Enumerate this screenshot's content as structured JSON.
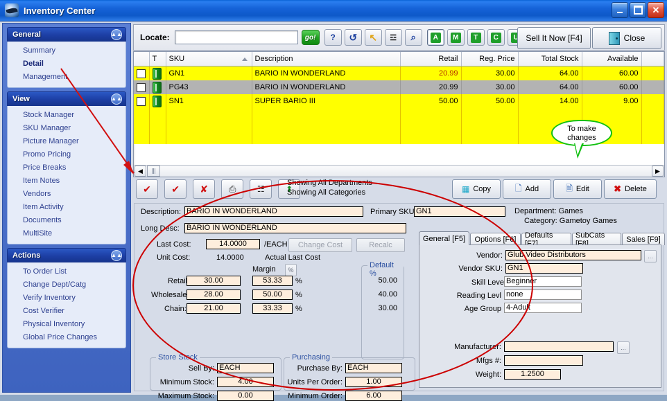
{
  "window": {
    "title": "Inventory Center",
    "logo_icon": "app-logo-icon",
    "minimize_label": "Minimize",
    "maximize_label": "Maximize",
    "close_label": "Close"
  },
  "sidebar": {
    "groups": [
      {
        "title": "General",
        "collapse_icon": "chevron-up-icon",
        "items": [
          {
            "label": "Summary",
            "active": false
          },
          {
            "label": "Detail",
            "active": true
          },
          {
            "label": "Management",
            "active": false
          }
        ]
      },
      {
        "title": "View",
        "collapse_icon": "chevron-up-icon",
        "items": [
          {
            "label": "Stock Manager",
            "active": false
          },
          {
            "label": "SKU Manager",
            "active": false
          },
          {
            "label": "Picture Manager",
            "active": false
          },
          {
            "label": "Promo Pricing",
            "active": false
          },
          {
            "label": "Price Breaks",
            "active": false
          },
          {
            "label": "Item Notes",
            "active": false
          },
          {
            "label": "Vendors",
            "active": false
          },
          {
            "label": "Item Activity",
            "active": false
          },
          {
            "label": "Documents",
            "active": false
          },
          {
            "label": "MultiSite",
            "active": false
          }
        ]
      },
      {
        "title": "Actions",
        "collapse_icon": "chevron-up-icon",
        "items": [
          {
            "label": "To Order List",
            "active": false
          },
          {
            "label": "Change Dept/Catg",
            "active": false
          },
          {
            "label": "Verify Inventory",
            "active": false
          },
          {
            "label": "Cost Verifier",
            "active": false
          },
          {
            "label": "Physical Inventory",
            "active": false
          },
          {
            "label": "Global Price Changes",
            "active": false
          }
        ]
      }
    ]
  },
  "locate_bar": {
    "label": "Locate:",
    "input_value": "",
    "input_placeholder": "",
    "go_label": "go!",
    "icon_buttons": [
      {
        "name": "help-icon",
        "glyph": "?"
      },
      {
        "name": "refresh-icon",
        "glyph": "↺"
      },
      {
        "name": "jump-icon",
        "glyph": "↖"
      },
      {
        "name": "find-icon",
        "glyph": "☲"
      },
      {
        "name": "preview-icon",
        "glyph": "⌕"
      }
    ],
    "filter_letters": [
      {
        "label": "A",
        "selected": true
      },
      {
        "label": "M",
        "selected": false
      },
      {
        "label": "T",
        "selected": false
      },
      {
        "label": "C",
        "selected": false
      },
      {
        "label": "U",
        "selected": false
      }
    ],
    "sell_it_now_label": "Sell It Now [F4]",
    "close_label": "Close",
    "close_icon": "exit-door-icon"
  },
  "grid": {
    "columns": [
      {
        "key": "check",
        "label": ""
      },
      {
        "key": "type",
        "label": "T"
      },
      {
        "key": "sku",
        "label": "SKU",
        "sorted": "asc"
      },
      {
        "key": "description",
        "label": "Description"
      },
      {
        "key": "retail",
        "label": "Retail",
        "align": "right"
      },
      {
        "key": "reg_price",
        "label": "Reg. Price",
        "align": "right"
      },
      {
        "key": "total_stock",
        "label": "Total Stock",
        "align": "right"
      },
      {
        "key": "available",
        "label": "Available",
        "align": "right"
      }
    ],
    "rows": [
      {
        "checked": false,
        "type_icon": "status-bar-icon",
        "sku": "GN1",
        "description": "BARIO IN WONDERLAND",
        "retail": "20.99",
        "retail_highlight": true,
        "reg_price": "30.00",
        "total_stock": "64.00",
        "available": "60.00",
        "selected": false
      },
      {
        "checked": false,
        "type_icon": "status-bar-icon",
        "sku": "PG43",
        "description": "BARIO IN WONDERLAND",
        "retail": "20.99",
        "retail_highlight": false,
        "reg_price": "30.00",
        "total_stock": "64.00",
        "available": "60.00",
        "selected": true
      },
      {
        "checked": false,
        "type_icon": "status-bar-icon",
        "sku": "SN1",
        "description": "SUPER BARIO III",
        "retail": "50.00",
        "retail_highlight": false,
        "reg_price": "50.00",
        "total_stock": "14.00",
        "available": "9.00",
        "selected": false
      }
    ],
    "scroll_left_icon": "scroll-left-icon",
    "scroll_right_icon": "scroll-right-icon"
  },
  "action_bar": {
    "icon_buttons": [
      {
        "name": "check-all-icon",
        "glyph": "✔"
      },
      {
        "name": "check-all-a-icon",
        "glyph": "✔"
      },
      {
        "name": "uncheck-all-icon",
        "glyph": "✘"
      },
      {
        "name": "print-icon",
        "glyph": "⎙"
      },
      {
        "name": "list-icon",
        "glyph": "☷"
      },
      {
        "name": "export-icon",
        "glyph": "⬆"
      }
    ],
    "showing_departments": "Showing All Departments",
    "showing_categories": "Showing All Categories",
    "buttons": [
      {
        "label": "Copy",
        "icon": "copy-icon"
      },
      {
        "label": "Add",
        "icon": "add-page-icon"
      },
      {
        "label": "Edit",
        "icon": "edit-page-icon"
      },
      {
        "label": "Delete",
        "icon": "delete-x-icon"
      }
    ]
  },
  "annotations": {
    "callout_line1": "To make",
    "callout_line2": "changes",
    "arrow_name": "red-arrow-annotation",
    "ellipse_name": "red-ellipse-annotation"
  },
  "detail": {
    "description_label": "Description:",
    "description_value": "BARIO IN WONDERLAND",
    "primary_sku_label": "Primary SKU:",
    "primary_sku_value": "GN1",
    "long_desc_label": "Long Desc:",
    "long_desc_value": "BARIO IN WONDERLAND",
    "department_label": "Department:",
    "department_value": "Games",
    "category_label": "Category:",
    "category_value": "Gametoy Games",
    "last_cost_label": "Last Cost:",
    "last_cost_value": "14.0000",
    "last_cost_unit": "/EACH",
    "change_cost_label": "Change Cost",
    "recalc_label": "Recalc",
    "unit_cost_label": "Unit Cost:",
    "unit_cost_value": "14.0000",
    "actual_last_cost_label": "Actual Last Cost",
    "margin_label": "Margin",
    "percent_button_glyph": "%",
    "default_pct_label": "Default %",
    "price_rows": [
      {
        "label": "Retail:",
        "price": "30.00",
        "margin": "53.33",
        "pct": "%",
        "default": "50.00"
      },
      {
        "label": "Wholesale:",
        "price": "28.00",
        "margin": "50.00",
        "pct": "%",
        "default": "40.00"
      },
      {
        "label": "Chain:",
        "price": "21.00",
        "margin": "33.33",
        "pct": "%",
        "default": "30.00"
      }
    ],
    "store_stock": {
      "title": "Store Stock",
      "fields": [
        {
          "label": "Sell By:",
          "value": "EACH",
          "align": "left"
        },
        {
          "label": "Minimum Stock:",
          "value": "4.00",
          "align": "center"
        },
        {
          "label": "Maximum Stock:",
          "value": "0.00",
          "align": "center"
        }
      ]
    },
    "purchasing": {
      "title": "Purchasing",
      "fields": [
        {
          "label": "Purchase By:",
          "value": "EACH",
          "align": "left"
        },
        {
          "label": "Units Per Order:",
          "value": "1.00",
          "align": "center"
        },
        {
          "label": "Minimum Order:",
          "value": "6.00",
          "align": "center"
        }
      ]
    },
    "tabs": [
      {
        "label": "General [F5]",
        "active": true
      },
      {
        "label": "Options [F6]",
        "active": false
      },
      {
        "label": "Defaults [F7]",
        "active": false
      },
      {
        "label": "SubCats [F8]",
        "active": false
      },
      {
        "label": "Sales [F9]",
        "active": false
      }
    ],
    "tab_panel": {
      "vendor_label": "Vendor:",
      "vendor_value": "Glub Video Distributors",
      "vendor_browse_label": "...",
      "vendor_sku_label": "Vendor SKU:",
      "vendor_sku_value": "GN1",
      "skill_level_label": "Skill Leve",
      "skill_level_value": "Beginner",
      "reading_level_label": "Reading Levl",
      "reading_level_value": "none",
      "age_group_label": "Age Group",
      "age_group_value": "4-Adult",
      "manufacturer_label": "Manufacturer:",
      "manufacturer_value": "",
      "manufacturer_browse_label": "...",
      "mfgs_label": "Mfgs #:",
      "mfgs_value": "",
      "weight_label": "Weight:",
      "weight_value": "1.2500"
    }
  },
  "colors": {
    "title_blue": "#1663d8",
    "row_yellow": "#ffff00",
    "row_selected": "#b3b3b3",
    "field_cream": "#feeedd",
    "annotation_red": "#cc0000",
    "accent_green": "#12c012"
  }
}
